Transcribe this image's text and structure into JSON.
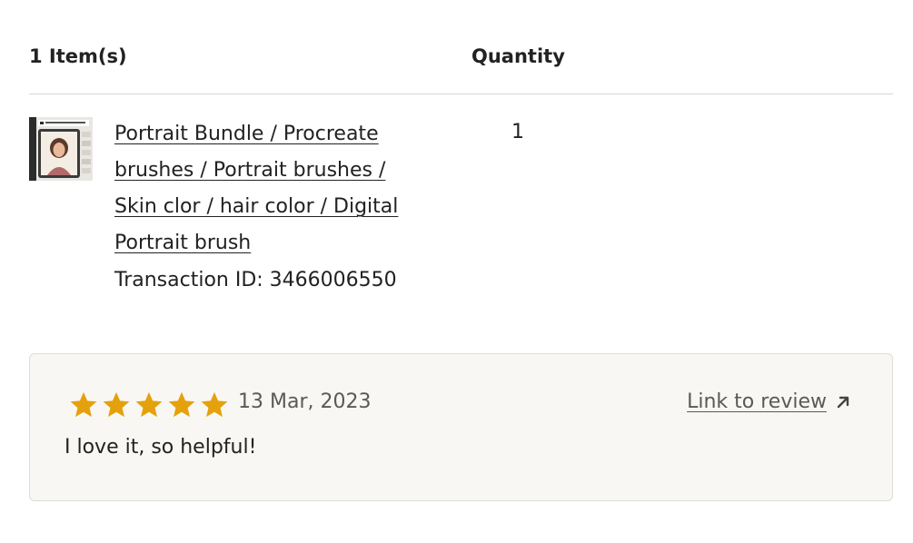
{
  "header": {
    "items_label": "1 Item(s)",
    "quantity_label": "Quantity"
  },
  "item": {
    "thumbnail_icon": "product-thumbnail-image",
    "title": "Portrait Bundle / Procreate brushes / Portrait brushes / Skin clor / hair color / Digital Portrait brush",
    "transaction": "Transaction ID: 3466006550",
    "quantity": "1"
  },
  "review": {
    "rating": 5,
    "rating_max": 5,
    "star_icon": "star-icon",
    "star_color": "#e5a10c",
    "date": "13 Mar, 2023",
    "link_label": "Link to review",
    "link_icon": "external-arrow-icon",
    "text": "I love it, so helpful!"
  },
  "colors": {
    "background": "#ffffff",
    "review_box_bg": "#f8f7f3",
    "text": "#222222",
    "muted_text": "#595959",
    "divider": "#d6d6d6"
  }
}
